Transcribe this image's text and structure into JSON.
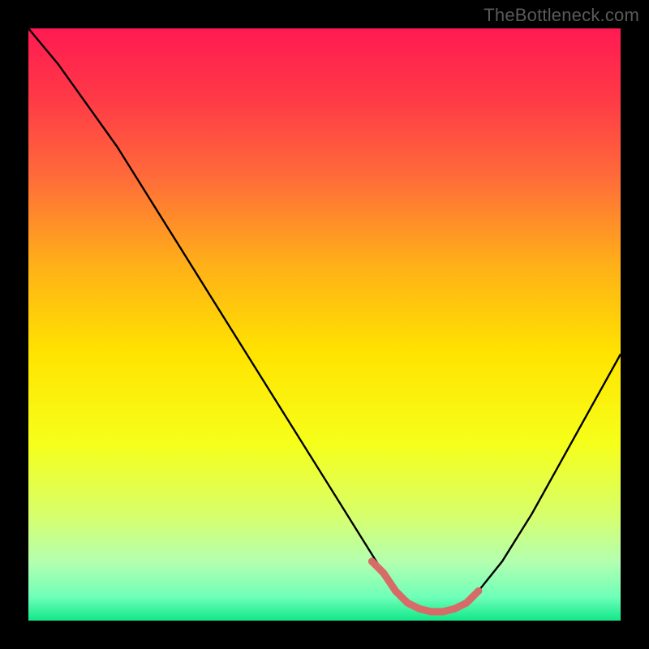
{
  "watermark": "TheBottleneck.com",
  "chart_data": {
    "type": "line",
    "title": "",
    "xlabel": "",
    "ylabel": "",
    "xlim": [
      0,
      100
    ],
    "ylim": [
      0,
      100
    ],
    "grid": false,
    "legend": false,
    "gradient_stops": [
      {
        "offset": 0.0,
        "color": "#ff1a52"
      },
      {
        "offset": 0.12,
        "color": "#ff3a47"
      },
      {
        "offset": 0.25,
        "color": "#ff6b3a"
      },
      {
        "offset": 0.4,
        "color": "#ffb018"
      },
      {
        "offset": 0.55,
        "color": "#ffe400"
      },
      {
        "offset": 0.7,
        "color": "#f6ff1a"
      },
      {
        "offset": 0.82,
        "color": "#d8ff6a"
      },
      {
        "offset": 0.9,
        "color": "#b4ffb0"
      },
      {
        "offset": 0.96,
        "color": "#6fffb8"
      },
      {
        "offset": 1.0,
        "color": "#12e88a"
      }
    ],
    "series": [
      {
        "name": "bottleneck-curve",
        "color": "#000000",
        "x": [
          0,
          5,
          10,
          15,
          20,
          25,
          30,
          35,
          40,
          45,
          50,
          55,
          60,
          62,
          64,
          66,
          68,
          70,
          72,
          74,
          76,
          80,
          85,
          90,
          95,
          100
        ],
        "y": [
          100,
          94,
          87,
          80,
          72,
          64,
          56,
          48,
          40,
          32,
          24,
          16,
          8,
          5,
          3,
          2,
          1.5,
          1.5,
          2,
          3,
          5,
          10,
          18,
          27,
          36,
          45
        ]
      }
    ],
    "highlight_segment": {
      "color": "#d76b68",
      "x": [
        58,
        60,
        62,
        64,
        66,
        68,
        70,
        72,
        74,
        76
      ],
      "y": [
        10,
        8,
        5,
        3,
        2,
        1.5,
        1.5,
        2,
        3,
        5
      ]
    },
    "highlight_points": {
      "color": "#d76b68",
      "radius": 4.5,
      "points": [
        {
          "x": 58,
          "y": 10
        },
        {
          "x": 76,
          "y": 5
        }
      ]
    }
  }
}
